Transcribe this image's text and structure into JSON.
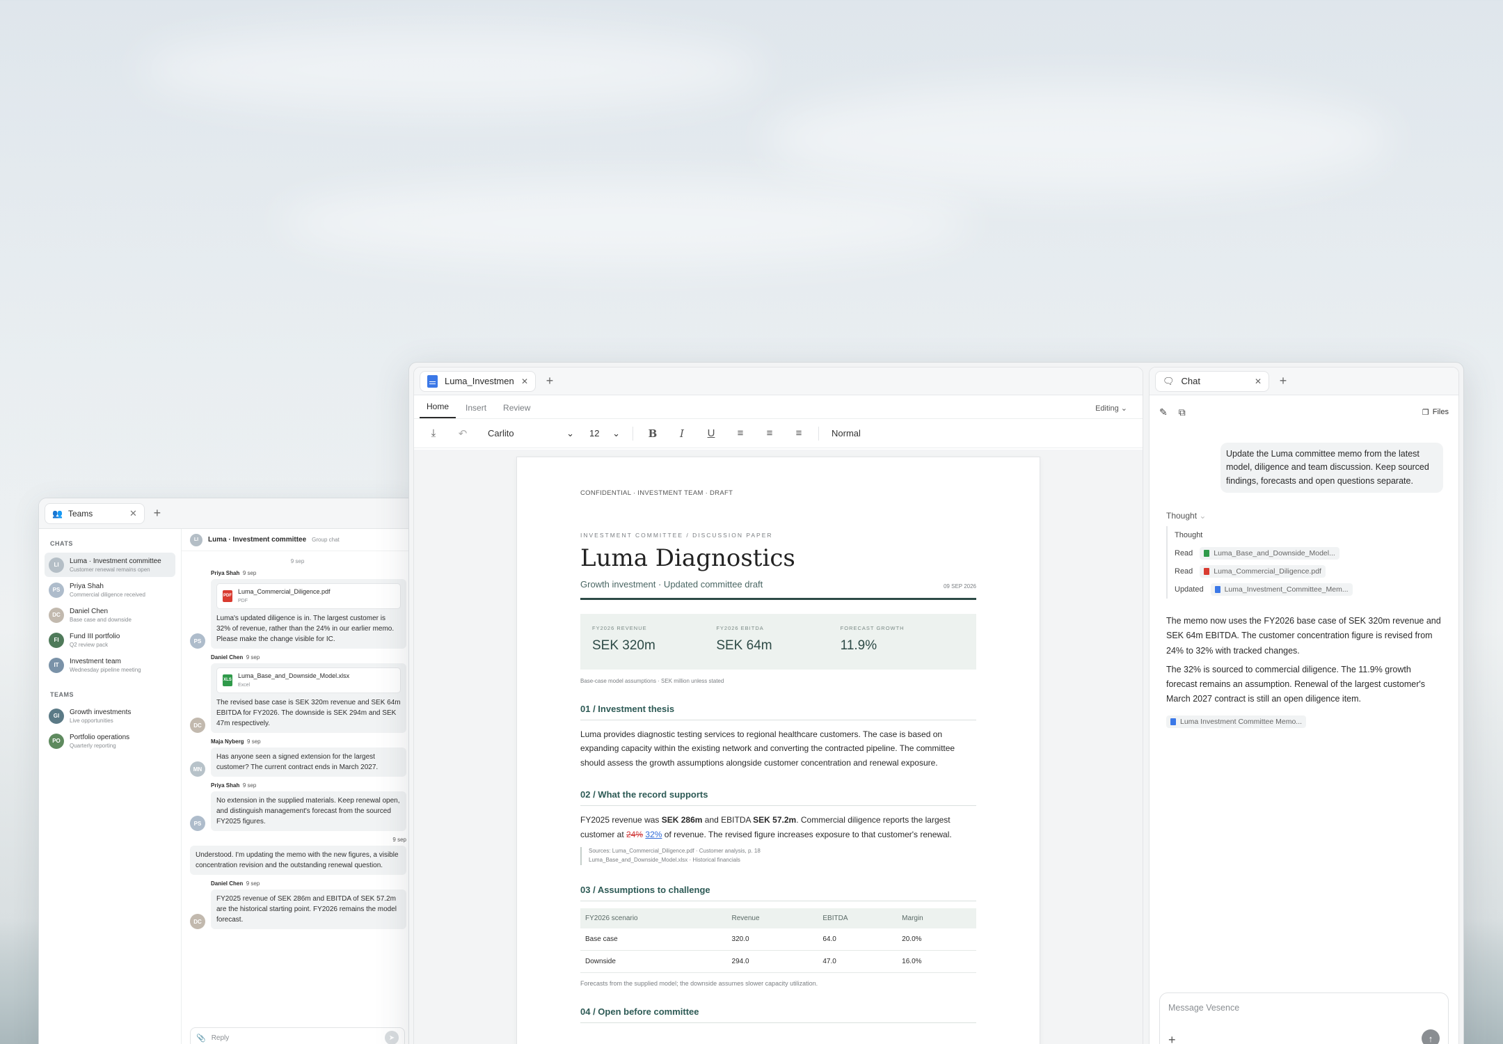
{
  "teams": {
    "tab_label": "Teams",
    "chats_heading": "CHATS",
    "chats": [
      {
        "initials": "LI",
        "name": "Luma · Investment committee",
        "sub": "Customer renewal remains open",
        "color": "#b4bec6"
      },
      {
        "initials": "PS",
        "name": "Priya Shah",
        "sub": "Commercial diligence received",
        "color": "#aebccb"
      },
      {
        "initials": "DC",
        "name": "Daniel Chen",
        "sub": "Base case and downside",
        "color": "#c2b9ae"
      },
      {
        "initials": "FI",
        "name": "Fund III portfolio",
        "sub": "Q2 review pack",
        "color": "#4f7a5a"
      },
      {
        "initials": "IT",
        "name": "Investment team",
        "sub": "Wednesday pipeline meeting",
        "color": "#7a92a8"
      }
    ],
    "teams_heading": "TEAMS",
    "team_list": [
      {
        "initials": "GI",
        "name": "Growth investments",
        "sub": "Live opportunities",
        "color": "#5b7a86"
      },
      {
        "initials": "PO",
        "name": "Portfolio operations",
        "sub": "Quarterly reporting",
        "color": "#5e8a5e"
      }
    ],
    "conversation": {
      "initials": "LI",
      "title": "Luma · Investment committee",
      "type": "Group chat",
      "day": "9 sep",
      "messages": [
        {
          "author": "Priya Shah",
          "time": "9 sep",
          "initials": "PS",
          "color": "#aebccb",
          "attachment": {
            "name": "Luma_Commercial_Diligence.pdf",
            "kind": "PDF",
            "icon_color": "#d93b30",
            "icon": "PDF"
          },
          "text": "Luma's updated diligence is in. The largest customer is 32% of revenue, rather than the 24% in our earlier memo. Please make the change visible for IC."
        },
        {
          "author": "Daniel Chen",
          "time": "9 sep",
          "initials": "DC",
          "color": "#c2b9ae",
          "attachment": {
            "name": "Luma_Base_and_Downside_Model.xlsx",
            "kind": "Excel",
            "icon_color": "#2f9a4a",
            "icon": "XLS"
          },
          "text": "The revised base case is SEK 320m revenue and SEK 64m EBITDA for FY2026. The downside is SEK 294m and SEK 47m respectively."
        },
        {
          "author": "Maja Nyberg",
          "time": "9 sep",
          "initials": "MN",
          "color": "#b7c2c9",
          "text": "Has anyone seen a signed extension for the largest customer? The current contract ends in March 2027."
        },
        {
          "author": "Priya Shah",
          "time": "9 sep",
          "initials": "PS",
          "color": "#aebccb",
          "text": "No extension in the supplied materials. Keep renewal open, and distinguish management's forecast from the sourced FY2025 figures."
        }
      ],
      "own_message": {
        "time": "9 sep",
        "text": "Understood. I'm updating the memo with the new figures, a visible concentration revision and the outstanding renewal question."
      },
      "last_message": {
        "author": "Daniel Chen",
        "time": "9 sep",
        "initials": "DC",
        "color": "#c2b9ae",
        "text": "FY2025 revenue of SEK 286m and EBITDA of SEK 57.2m are the historical starting point. FY2026 remains the model forecast."
      },
      "reply_placeholder": "Reply"
    }
  },
  "doc": {
    "tab_label": "Luma_Investment",
    "ribbon_tabs": [
      "Home",
      "Insert",
      "Review"
    ],
    "mode": "Editing",
    "font": "Carlito",
    "font_size": "12",
    "style": "Normal",
    "confidential": "CONFIDENTIAL · INVESTMENT TEAM · DRAFT",
    "kicker": "INVESTMENT COMMITTEE / DISCUSSION PAPER",
    "title": "Luma Diagnostics",
    "subtitle": "Growth investment · Updated committee draft",
    "date": "09 SEP 2026",
    "kpis": [
      {
        "label": "FY2026 REVENUE",
        "value": "SEK 320m"
      },
      {
        "label": "FY2026 EBITDA",
        "value": "SEK 64m"
      },
      {
        "label": "FORECAST GROWTH",
        "value": "11.9%"
      }
    ],
    "kpi_note": "Base-case model assumptions · SEK million unless stated",
    "sections": {
      "s1_title": "01 / Investment thesis",
      "s1_text": "Luma provides diagnostic testing services to regional healthcare customers. The case is based on expanding capacity within the existing network and converting the contracted pipeline. The committee should assess the growth assumptions alongside customer concentration and renewal exposure.",
      "s2_title": "02 / What the record supports",
      "s2_a": "FY2025 revenue was ",
      "s2_b": "SEK 286m",
      "s2_c": " and EBITDA ",
      "s2_d": "SEK 57.2m",
      "s2_e": ". Commercial diligence reports the largest customer at ",
      "s2_del": "24%",
      "s2_ins": "32%",
      "s2_f": " of revenue. The revised figure increases exposure to that customer's renewal.",
      "source1": "Sources: Luma_Commercial_Diligence.pdf · Customer analysis, p. 18",
      "source2": "Luma_Base_and_Downside_Model.xlsx · Historical financials",
      "s3_title": "03 / Assumptions to challenge",
      "table_headers": [
        "FY2026 scenario",
        "Revenue",
        "EBITDA",
        "Margin"
      ],
      "table_rows": [
        [
          "Base case",
          "320.0",
          "64.0",
          "20.0%"
        ],
        [
          "Downside",
          "294.0",
          "47.0",
          "16.0%"
        ]
      ],
      "table_note": "Forecasts from the supplied model; the downside assumes slower capacity utilization.",
      "s4_title": "04 / Open before committee"
    }
  },
  "chat": {
    "tab_label": "Chat",
    "files_label": "Files",
    "user_message": "Update the Luma committee memo from the latest model, diligence and team discussion. Keep sourced findings, forecasts and open questions separate.",
    "thought_label": "Thought",
    "trace": [
      {
        "action": "Thought"
      },
      {
        "action": "Read",
        "file": "Luma_Base_and_Downside_Model...",
        "color": "#2f9a4a"
      },
      {
        "action": "Read",
        "file": "Luma_Commercial_Diligence.pdf",
        "color": "#d93b30"
      },
      {
        "action": "Updated",
        "file": "Luma_Investment_Committee_Mem...",
        "color": "#3b78e7"
      }
    ],
    "answer_p1": "The memo now uses the FY2026 base case of SEK 320m revenue and SEK 64m EBITDA. The customer concentration figure is revised from 24% to 32% with tracked changes.",
    "answer_p2": "The 32% is sourced to commercial diligence. The 11.9% growth forecast remains an assumption. Renewal of the largest customer's March 2027 contract is still an open diligence item.",
    "answer_file": "Luma Investment Committee Memo...",
    "composer_placeholder": "Message Vesence"
  }
}
